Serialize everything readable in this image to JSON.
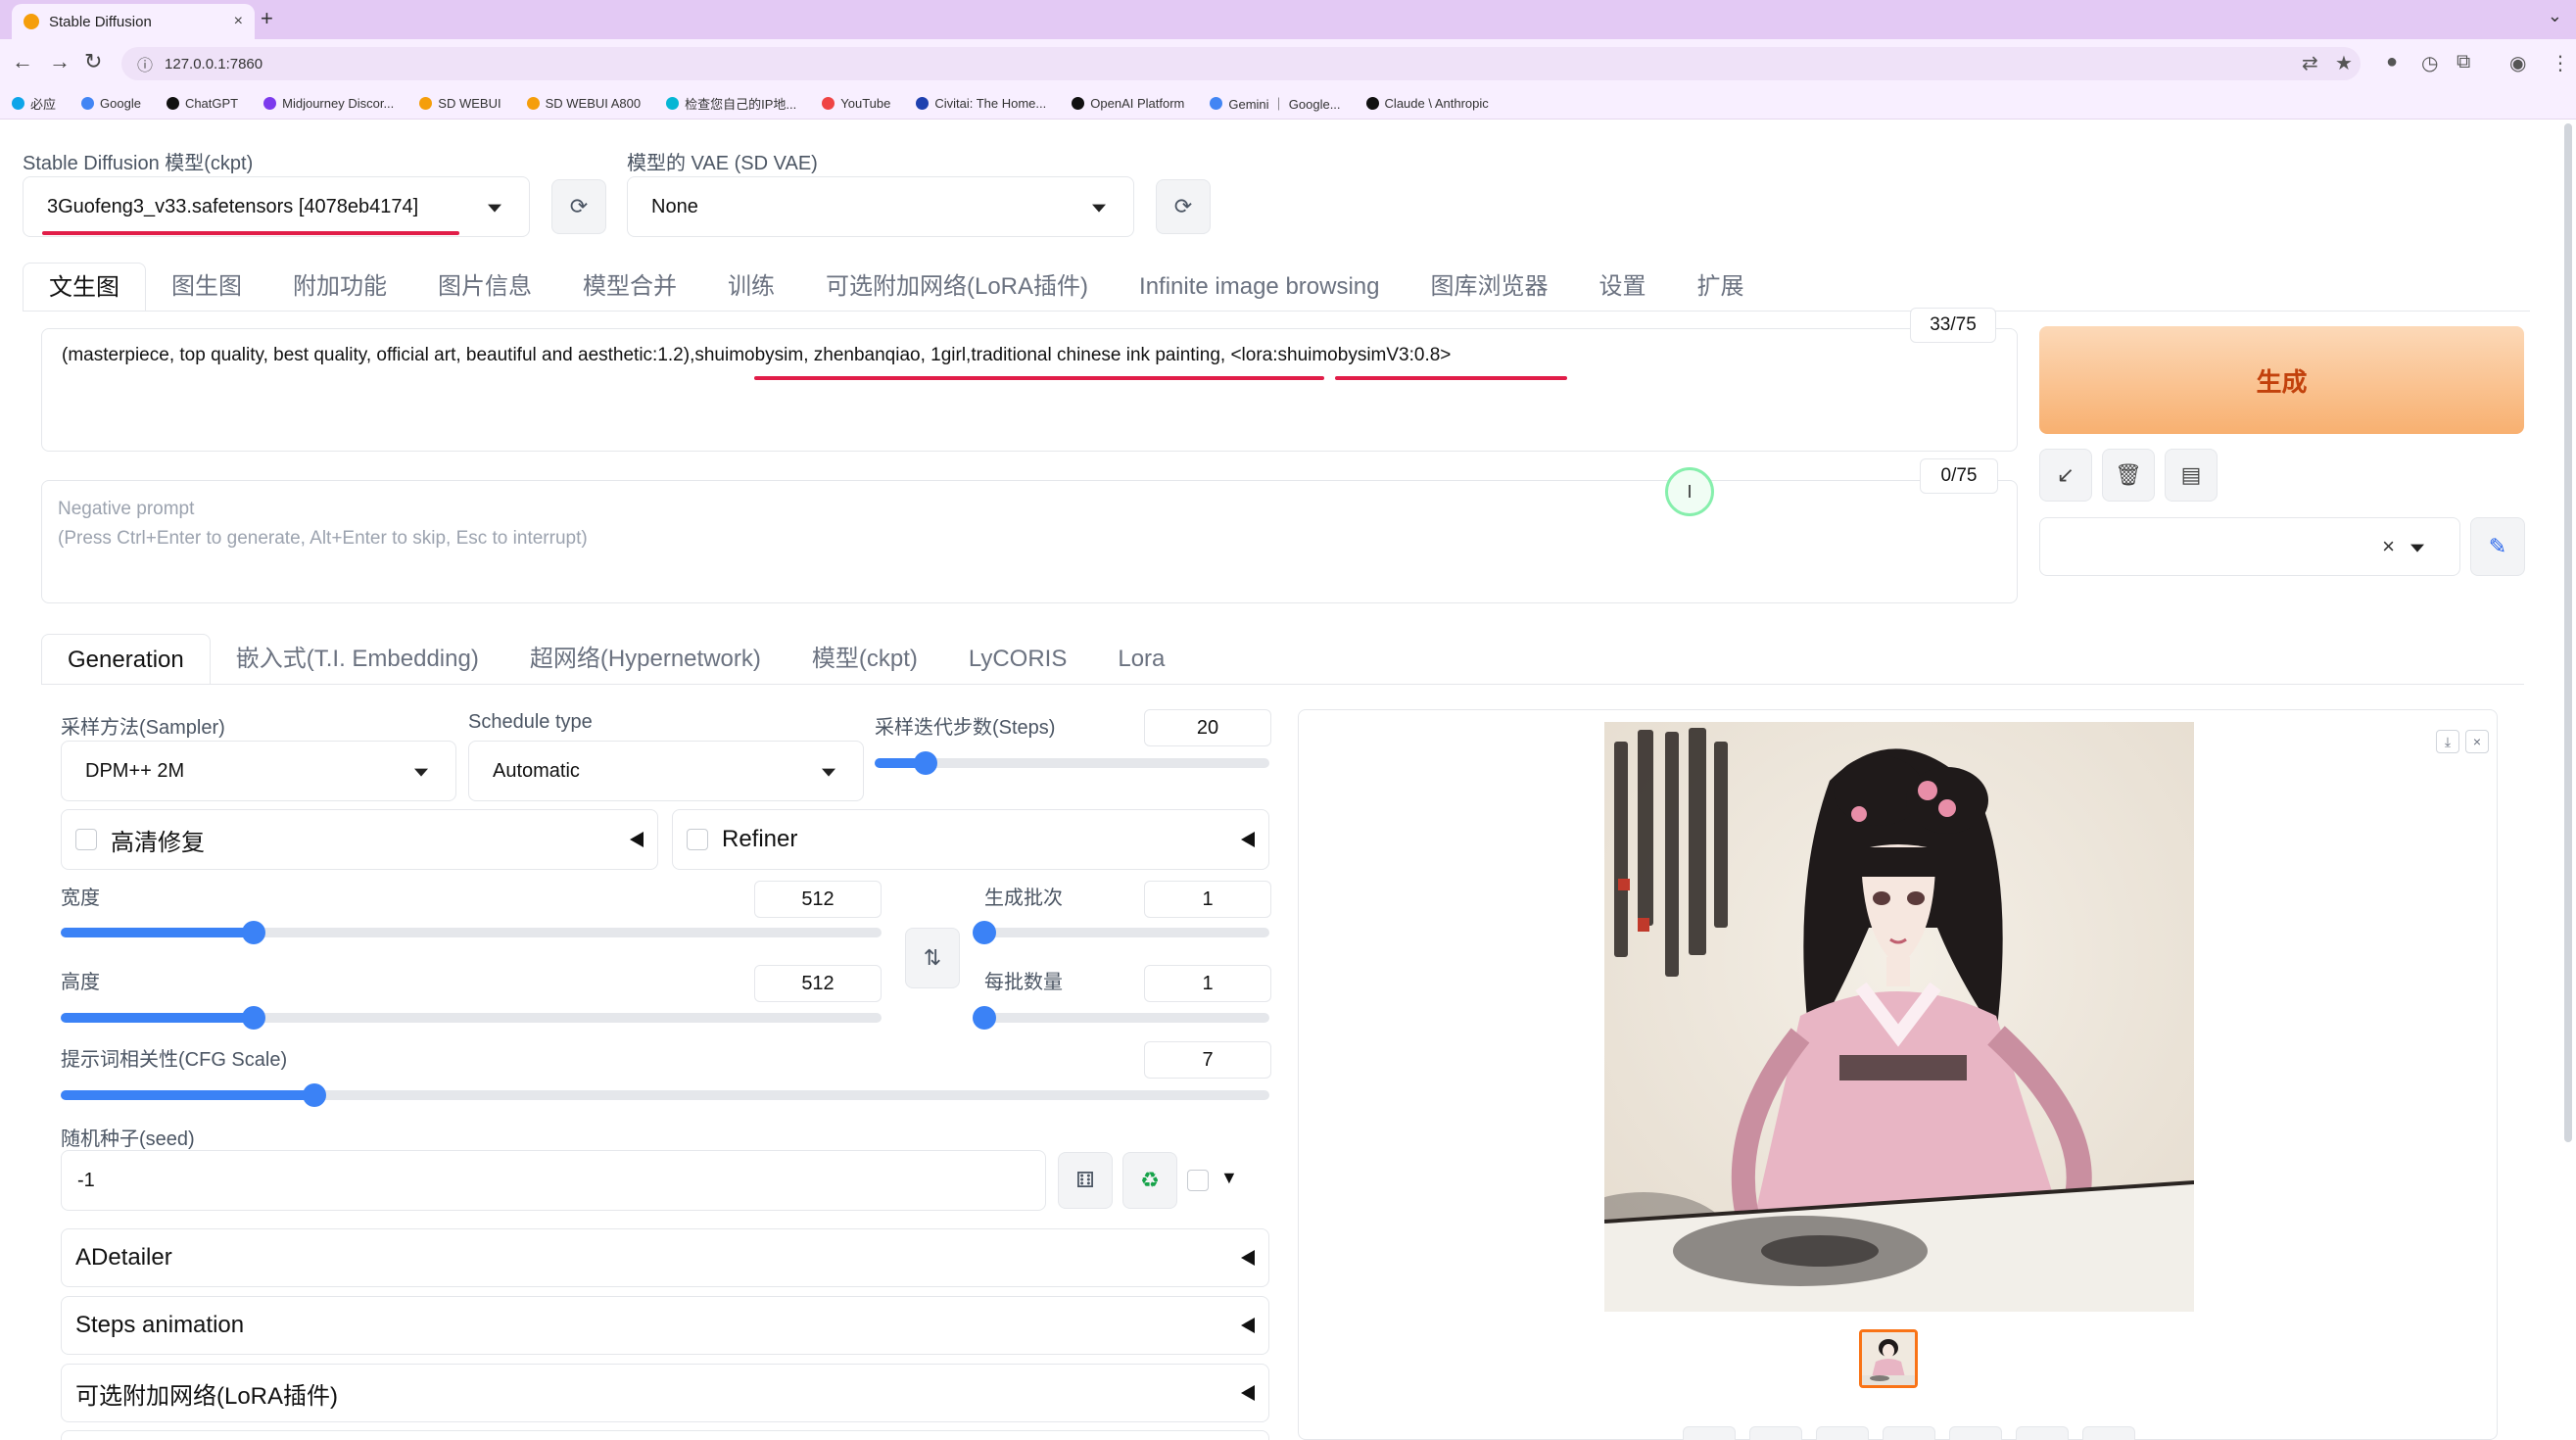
{
  "browser": {
    "tab_title": "Stable Diffusion",
    "tab_close": "×",
    "new_tab": "+",
    "url": "127.0.0.1:7860",
    "bookmarks": [
      {
        "label": "必应",
        "color": "#0ea5e9"
      },
      {
        "label": "Google",
        "color": "#4285f4"
      },
      {
        "label": "ChatGPT",
        "color": "#111111"
      },
      {
        "label": "Midjourney Discor...",
        "color": "#7c3aed"
      },
      {
        "label": "SD WEBUI",
        "color": "#f59e0b"
      },
      {
        "label": "SD WEBUI A800",
        "color": "#f59e0b"
      },
      {
        "label": "检查您自己的IP地...",
        "color": "#06b6d4"
      },
      {
        "label": "YouTube",
        "color": "#ef4444"
      },
      {
        "label": "Civitai: The Home...",
        "color": "#1e40af"
      },
      {
        "label": "OpenAI Platform",
        "color": "#111111"
      },
      {
        "label": "Gemini ｜ Google...",
        "color": "#4285f4"
      },
      {
        "label": "Claude \\ Anthropic",
        "color": "#111111"
      }
    ]
  },
  "model": {
    "ckpt_label": "Stable Diffusion 模型(ckpt)",
    "ckpt_value": "3Guofeng3_v33.safetensors [4078eb4174]",
    "vae_label": "模型的 VAE (SD VAE)",
    "vae_value": "None"
  },
  "main_tabs": [
    "文生图",
    "图生图",
    "附加功能",
    "图片信息",
    "模型合并",
    "训练",
    "可选附加网络(LoRA插件)",
    "Infinite image browsing",
    "图库浏览器",
    "设置",
    "扩展"
  ],
  "prompt": {
    "text": "(masterpiece, top quality, best quality, official art, beautiful and aesthetic:1.2),shuimobysim, zhenbanqiao,  1girl,traditional chinese ink painting, <lora:shuimobysimV3:0.8>",
    "token_count": "33/75",
    "negative_placeholder_1": "Negative prompt",
    "negative_placeholder_2": "(Press Ctrl+Enter to generate, Alt+Enter to skip, Esc to interrupt)",
    "negative_count": "0/75"
  },
  "generate_label": "生成",
  "style_clear": "×",
  "sub_tabs": [
    "Generation",
    "嵌入式(T.I. Embedding)",
    "超网络(Hypernetwork)",
    "模型(ckpt)",
    "LyCORIS",
    "Lora"
  ],
  "generation": {
    "sampler_label": "采样方法(Sampler)",
    "sampler_value": "DPM++ 2M",
    "schedule_label": "Schedule type",
    "schedule_value": "Automatic",
    "steps_label": "采样迭代步数(Steps)",
    "steps_value": "20",
    "steps_fraction": 0.13,
    "hires_label": "高清修复",
    "refiner_label": "Refiner",
    "width_label": "宽度",
    "width_value": "512",
    "width_fraction": 0.235,
    "height_label": "高度",
    "height_value": "512",
    "height_fraction": 0.235,
    "batch_count_label": "生成批次",
    "batch_count_value": "1",
    "batch_count_fraction": 0.0,
    "batch_size_label": "每批数量",
    "batch_size_value": "1",
    "batch_size_fraction": 0.0,
    "cfg_label": "提示词相关性(CFG Scale)",
    "cfg_value": "7",
    "cfg_fraction": 0.21,
    "seed_label": "随机种子(seed)",
    "seed_value": "-1",
    "accordions": [
      "ADetailer",
      "Steps animation",
      "可选附加网络(LoRA插件)"
    ]
  },
  "colors": {
    "accent": "#3b82f6",
    "generate_text": "#c2410c",
    "highlight_line": "#e11d48"
  }
}
